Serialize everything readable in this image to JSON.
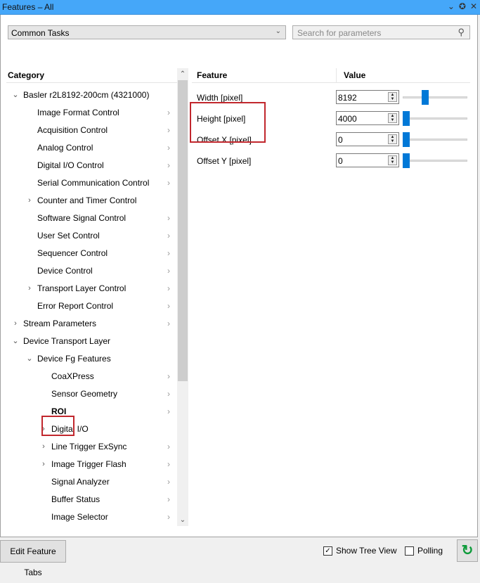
{
  "window": {
    "title": "Features – All",
    "icons": [
      "chevron-down-icon",
      "pin-icon",
      "close-icon"
    ]
  },
  "toolbar": {
    "combo_value": "Common Tasks",
    "search_placeholder": "Search for parameters"
  },
  "category": {
    "header": "Category",
    "items": [
      {
        "label": "Basler r2L8192-200cm (4321000)",
        "level": 0,
        "expander": "expanded",
        "chevron": false
      },
      {
        "label": "Image Format Control",
        "level": 1,
        "expander": "none",
        "chevron": true
      },
      {
        "label": "Acquisition Control",
        "level": 1,
        "expander": "none",
        "chevron": true
      },
      {
        "label": "Analog Control",
        "level": 1,
        "expander": "none",
        "chevron": true
      },
      {
        "label": "Digital I/O Control",
        "level": 1,
        "expander": "none",
        "chevron": true
      },
      {
        "label": "Serial Communication Control",
        "level": 1,
        "expander": "none",
        "chevron": true
      },
      {
        "label": "Counter and Timer Control",
        "level": 1,
        "expander": "collapsed",
        "chevron": false
      },
      {
        "label": "Software Signal Control",
        "level": 1,
        "expander": "none",
        "chevron": true
      },
      {
        "label": "User Set Control",
        "level": 1,
        "expander": "none",
        "chevron": true
      },
      {
        "label": "Sequencer Control",
        "level": 1,
        "expander": "none",
        "chevron": true
      },
      {
        "label": "Device Control",
        "level": 1,
        "expander": "none",
        "chevron": true
      },
      {
        "label": "Transport Layer Control",
        "level": 1,
        "expander": "collapsed",
        "chevron": true
      },
      {
        "label": "Error Report Control",
        "level": 1,
        "expander": "none",
        "chevron": true
      },
      {
        "label": "Stream Parameters",
        "level": 0,
        "expander": "collapsed",
        "chevron": true
      },
      {
        "label": "Device Transport Layer",
        "level": 0,
        "expander": "expanded",
        "chevron": false
      },
      {
        "label": "Device Fg Features",
        "level": 1,
        "expander": "expanded",
        "chevron": false
      },
      {
        "label": "CoaXPress",
        "level": 2,
        "expander": "none",
        "chevron": true
      },
      {
        "label": "Sensor Geometry",
        "level": 2,
        "expander": "none",
        "chevron": true
      },
      {
        "label": "ROI",
        "level": 2,
        "expander": "none",
        "chevron": true,
        "selected": true
      },
      {
        "label": "Digital I/O",
        "level": 2,
        "expander": "collapsed",
        "chevron": false
      },
      {
        "label": "Line Trigger ExSync",
        "level": 2,
        "expander": "collapsed",
        "chevron": true
      },
      {
        "label": "Image Trigger Flash",
        "level": 2,
        "expander": "collapsed",
        "chevron": true
      },
      {
        "label": "Signal Analyzer",
        "level": 2,
        "expander": "none",
        "chevron": true
      },
      {
        "label": "Buffer Status",
        "level": 2,
        "expander": "none",
        "chevron": true
      },
      {
        "label": "Image Selector",
        "level": 2,
        "expander": "none",
        "chevron": true
      }
    ]
  },
  "features": {
    "header_feature": "Feature",
    "header_value": "Value",
    "rows": [
      {
        "label": "Width [pixel]",
        "value": "8192",
        "slider_fraction": 0.33
      },
      {
        "label": "Height [pixel]",
        "value": "4000",
        "slider_fraction": 0.0
      },
      {
        "label": "Offset X [pixel]",
        "value": "0",
        "slider_fraction": 0.0
      },
      {
        "label": "Offset Y [pixel]",
        "value": "0",
        "slider_fraction": 0.0
      }
    ]
  },
  "bottom": {
    "edit_tabs_label": "Edit Feature Tabs",
    "show_tree_label": "Show Tree View",
    "show_tree_checked": true,
    "polling_label": "Polling",
    "polling_checked": false
  },
  "colors": {
    "titlebar": "#45a7f9",
    "highlight": "#c1272d",
    "slider": "#0078d7",
    "refresh": "#0d9b3a"
  }
}
